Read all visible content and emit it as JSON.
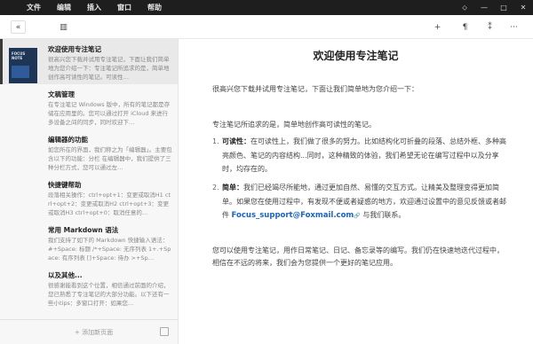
{
  "menubar": {
    "items": [
      {
        "label": "文件"
      },
      {
        "label": "编辑"
      },
      {
        "label": "插入"
      },
      {
        "label": "窗口"
      },
      {
        "label": "帮助"
      }
    ],
    "window_controls": {
      "pin": "⬦",
      "minimize": "—",
      "maximize": "□",
      "close": "✕"
    }
  },
  "toolbar": {
    "collapse_glyph": "«",
    "sidebar_glyph": "▥",
    "add_glyph": "+",
    "paragraph_glyph": "¶",
    "magic_glyph": "⁑",
    "more_glyph": "···"
  },
  "sidebar": {
    "notes": [
      {
        "title": "欢迎使用专注笔记",
        "excerpt": "很高兴您下载并试用专注笔记，下面让我们简单地为您介绍一下：专注笔记所追求的是，简单地创作高可读性的笔记。可读性…",
        "thumb_text": "FOCUS NOTE",
        "active": true
      },
      {
        "title": "文稿管理",
        "excerpt": "在专注笔记 Windows 版中，所有的笔记都是存储在应用里的。您可以通过打开 iCloud 来进行多设备之间的同步，同时欢迎下…"
      },
      {
        "title": "编辑器的功能",
        "excerpt": "如您所在的界面，我们称之为「编辑器」。主要包含以下的功能：分栏 在编辑器中，我们提供了三种分栏方式，您可以通过左…"
      },
      {
        "title": "快捷键帮助",
        "excerpt": "段落相关操作：ctrl+opt+1：变更或取消H1 ctrl+opt+2：变更或取消H2 ctrl+opt+3：变更或取消H3 ctrl+opt+0：取消任意的…"
      },
      {
        "title": "常用 Markdown 语法",
        "excerpt": "我们支持了如下的 Markdown 快捷输入语法：#+Space: 标题 /*+Space: 无序列表 1+.+Space: 有序列表 []+Space: 待办 >+Sp…"
      },
      {
        "title": "以及其他...",
        "excerpt": "很感谢能看到这个位置，相信通过前面的介绍，您已熟悉了专注笔记的大部分功能。以下还有一些小tips：多窗口打开：如果您…"
      }
    ],
    "add_page_label": "+ 添加新页面"
  },
  "document": {
    "title": "欢迎使用专注笔记",
    "intro": "很高兴您下载并试用专注笔记，下面让我们简单地为您介绍一下：",
    "pursuit": "专注笔记所追求的是，简单地创作高可读性的笔记。",
    "list": [
      {
        "num": "1.",
        "label": "可读性：",
        "text": "在可读性上，我们做了很多的努力。比如结构化可折叠的段落、总结外框、多种高亮颜色、笔记的内容结构...同时，这种精致的体验，我们希望无论在编写过程中以及分享时，均存在的。"
      },
      {
        "num": "2.",
        "label": "简单：",
        "text_before": "我们已经竭尽所能地，通过更加自然、易懂的交互方式。让精美及整理变得更加简单。如果您在使用过程中，有发现不便或者疑惑的地方，欢迎通过设置中的意见反馈或者邮件 ",
        "email": "Focus_support@Foxmail.com",
        "text_after": " 与我们联系。"
      }
    ],
    "closing": "您可以使用专注笔记，用作日常笔记、日记、备忘录等的编写。我们仍在快速地迭代过程中，相信在不远的将来，我们会为您提供一个更好的笔记应用。"
  },
  "colors": {
    "accent_link": "#1a63c4",
    "menubar_bg": "#1e1e1e",
    "sidebar_bg": "#f7f7f7"
  }
}
